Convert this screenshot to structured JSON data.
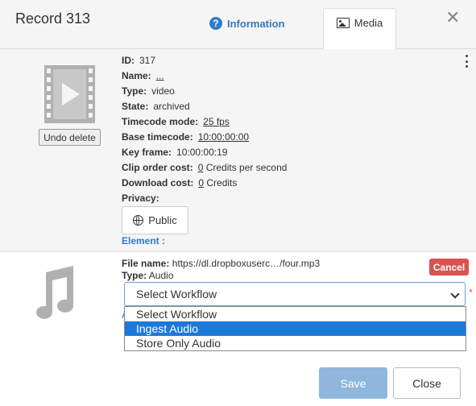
{
  "header": {
    "title": "Record 313",
    "tabs": [
      {
        "label": "Information",
        "icon": "question-circle-icon",
        "active": false
      },
      {
        "label": "Media",
        "icon": "image-icon",
        "active": true
      }
    ],
    "close_icon": "close-icon"
  },
  "record": {
    "undo_label": "Undo delete",
    "fields": [
      {
        "label": "ID:",
        "value": "317",
        "underline": false
      },
      {
        "label": "Name:",
        "value": "...",
        "underline": true
      },
      {
        "label": "Type:",
        "value": "video",
        "underline": false
      },
      {
        "label": "State:",
        "value": "archived",
        "underline": false
      },
      {
        "label": "Timecode mode:",
        "value": "25 fps",
        "underline": true
      },
      {
        "label": "Base timecode:",
        "value": "10:00:00:00",
        "underline": true
      },
      {
        "label": "Key frame:",
        "value": "10:00:00:19",
        "underline": false
      },
      {
        "label": "Clip order cost:",
        "value": "0",
        "suffix": " Credits per second",
        "underline": true
      },
      {
        "label": "Download cost:",
        "value": "0",
        "suffix": " Credits",
        "underline": true
      },
      {
        "label": "Privacy:",
        "value": "",
        "underline": false
      }
    ],
    "privacy_button": "Public",
    "element_label": "Element :"
  },
  "upload": {
    "file_name_label": "File name:",
    "file_name_value": "https://dl.dropboxuserc…/four.mp3",
    "type_label": "Type:",
    "type_value": "Audio",
    "cancel_label": "Cancel",
    "select_value": "Select Workflow",
    "required_mark": "*",
    "hidden_char": "A",
    "options": [
      {
        "label": "Select Workflow",
        "highlighted": false
      },
      {
        "label": "Ingest Audio",
        "highlighted": true
      },
      {
        "label": "Store Only Audio",
        "highlighted": false
      }
    ]
  },
  "footer": {
    "save_label": "Save",
    "close_label": "Close"
  },
  "colors": {
    "accent": "#2a7dc8",
    "danger": "#d9534f",
    "save_disabled": "#8fb6dd",
    "highlight": "#1e78d7"
  }
}
